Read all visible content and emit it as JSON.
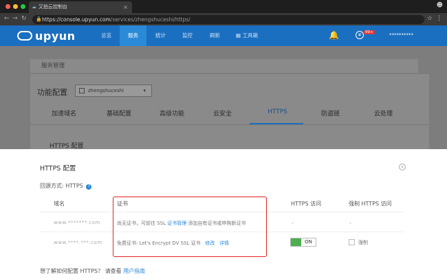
{
  "browser": {
    "tab_title": "又拍云控制台",
    "url_host": "https://console.upyun.com",
    "url_path": "/services/zhengshuceshi/https/"
  },
  "header": {
    "logo_text": "upyun",
    "nav": [
      "总览",
      "服务",
      "统计",
      "监控",
      "刷新",
      "工具箱"
    ],
    "active_nav": "服务",
    "badge": "99+",
    "user": "**********"
  },
  "background": {
    "breadcrumb": "服务管理",
    "config_label": "功能配置",
    "service_select": "zhengshuceshi",
    "tabs": [
      "加速域名",
      "基础配置",
      "高级功能",
      "云安全",
      "HTTPS",
      "防盗链",
      "云处理"
    ],
    "active_tab": "HTTPS",
    "section_title": "HTTPS 配置"
  },
  "modal": {
    "title": "HTTPS 配置",
    "origin_label": "回源方式:",
    "origin_value": "HTTPS",
    "columns": [
      "域名",
      "证书",
      "HTTPS 访问",
      "强制 HTTPS 访问"
    ],
    "rows": [
      {
        "domain": "www.*******.com",
        "cert_prefix": "尚无证书，可前往 SSL ",
        "cert_link": "证书管理",
        "cert_suffix": " 添加自有证书或申购新证书",
        "https": "-",
        "force": "-"
      },
      {
        "domain": "www.****.***.com",
        "cert_prefix": "免费证书: Let's Encrypt DV SSL 证书",
        "cert_link": "修改",
        "cert_link2": "详情",
        "https_toggle": "ON",
        "force_label": "强制"
      }
    ],
    "footer_prefix": "想了解如何配置 HTTPS？ 请查看 ",
    "footer_link": "用户指南"
  },
  "colors": {
    "brand": "#1b6fc0",
    "highlight_box": "#e02020",
    "toggle_on": "#4caf50"
  }
}
